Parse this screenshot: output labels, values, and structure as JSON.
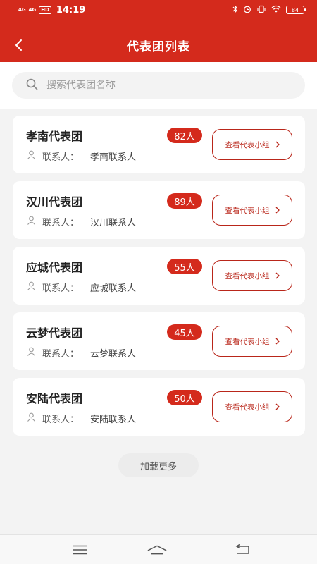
{
  "status_bar": {
    "signal1": "4G",
    "signal2": "4G",
    "hd": "HD",
    "time": "14:19",
    "battery": "84"
  },
  "header": {
    "title": "代表团列表"
  },
  "search": {
    "placeholder": "搜索代表团名称"
  },
  "delegations": [
    {
      "name": "孝南代表团",
      "count": "82人",
      "contact_label": "联系人：",
      "contact": "孝南联系人",
      "button": "查看代表小组"
    },
    {
      "name": "汉川代表团",
      "count": "89人",
      "contact_label": "联系人：",
      "contact": "汉川联系人",
      "button": "查看代表小组"
    },
    {
      "name": "应城代表团",
      "count": "55人",
      "contact_label": "联系人：",
      "contact": "应城联系人",
      "button": "查看代表小组"
    },
    {
      "name": "云梦代表团",
      "count": "45人",
      "contact_label": "联系人：",
      "contact": "云梦联系人",
      "button": "查看代表小组"
    },
    {
      "name": "安陆代表团",
      "count": "50人",
      "contact_label": "联系人：",
      "contact": "安陆联系人",
      "button": "查看代表小组"
    }
  ],
  "load_more": "加载更多",
  "colors": {
    "primary": "#d42a1c",
    "background": "#f3f3f3"
  }
}
